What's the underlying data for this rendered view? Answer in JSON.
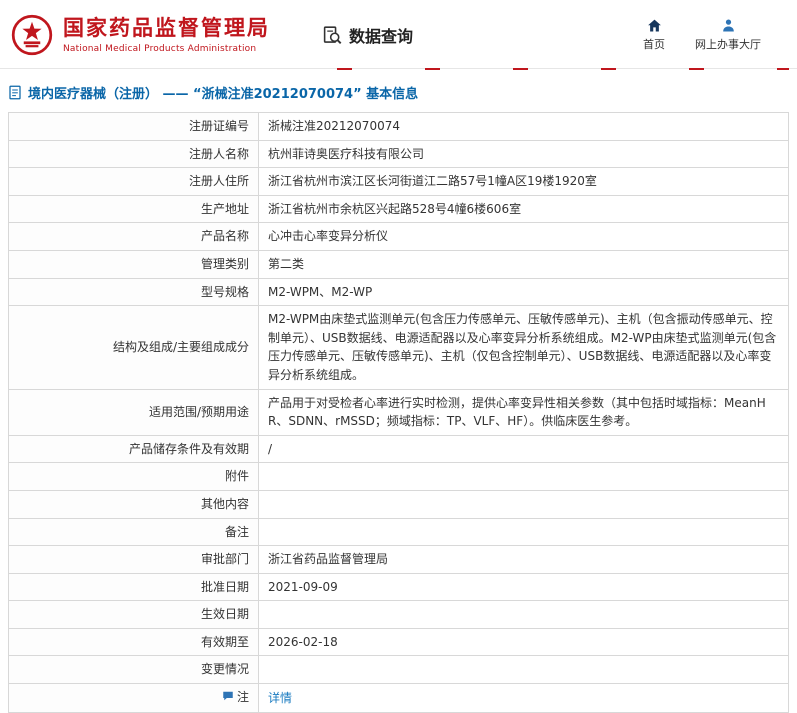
{
  "colors": {
    "brand_red": "#c0161d",
    "title_blue": "#0a66a8",
    "link_blue": "#1a7bc0",
    "nav_home_icon": "#16365c",
    "nav_person_icon": "#2e74b5",
    "table_border": "#d8d8d8"
  },
  "header": {
    "org_name_cn": "国家药品监督管理局",
    "org_name_en": "National Medical Products Administration",
    "section_title": "数据查询",
    "nav_home": "首页",
    "nav_service_hall": "网上办事大厅"
  },
  "page": {
    "title": "境内医疗器械（注册） ——  “浙械注准20212070074”  基本信息"
  },
  "table": {
    "rows": [
      {
        "label": "注册证编号",
        "value": "浙械注准20212070074"
      },
      {
        "label": "注册人名称",
        "value": "杭州菲诗奥医疗科技有限公司"
      },
      {
        "label": "注册人住所",
        "value": "浙江省杭州市滨江区长河街道江二路57号1幢A区19楼1920室"
      },
      {
        "label": "生产地址",
        "value": "浙江省杭州市余杭区兴起路528号4幢6楼606室"
      },
      {
        "label": "产品名称",
        "value": "心冲击心率变异分析仪"
      },
      {
        "label": "管理类别",
        "value": "第二类"
      },
      {
        "label": "型号规格",
        "value": "M2-WPM、M2-WP"
      },
      {
        "label": "结构及组成/主要组成成分",
        "value": "M2-WPM由床垫式监测单元(包含压力传感单元、压敏传感单元)、主机（包含振动传感单元、控制单元）、USB数据线、电源适配器以及心率变异分析系统组成。M2-WP由床垫式监测单元(包含压力传感单元、压敏传感单元)、主机（仅包含控制单元）、USB数据线、电源适配器以及心率变异分析系统组成。"
      },
      {
        "label": "适用范围/预期用途",
        "value": "产品用于对受检者心率进行实时检测，提供心率变异性相关参数（其中包括时域指标：MeanHR、SDNN、rMSSD；频域指标：TP、VLF、HF）。供临床医生参考。"
      },
      {
        "label": "产品储存条件及有效期",
        "value": "/"
      },
      {
        "label": "附件",
        "value": ""
      },
      {
        "label": "其他内容",
        "value": ""
      },
      {
        "label": "备注",
        "value": ""
      },
      {
        "label": "审批部门",
        "value": "浙江省药品监督管理局"
      },
      {
        "label": "批准日期",
        "value": "2021-09-09"
      },
      {
        "label": "生效日期",
        "value": ""
      },
      {
        "label": "有效期至",
        "value": "2026-02-18"
      },
      {
        "label": "变更情况",
        "value": ""
      },
      {
        "label": "注",
        "value": "详情",
        "link": true,
        "label_icon": "comment-icon"
      }
    ]
  }
}
